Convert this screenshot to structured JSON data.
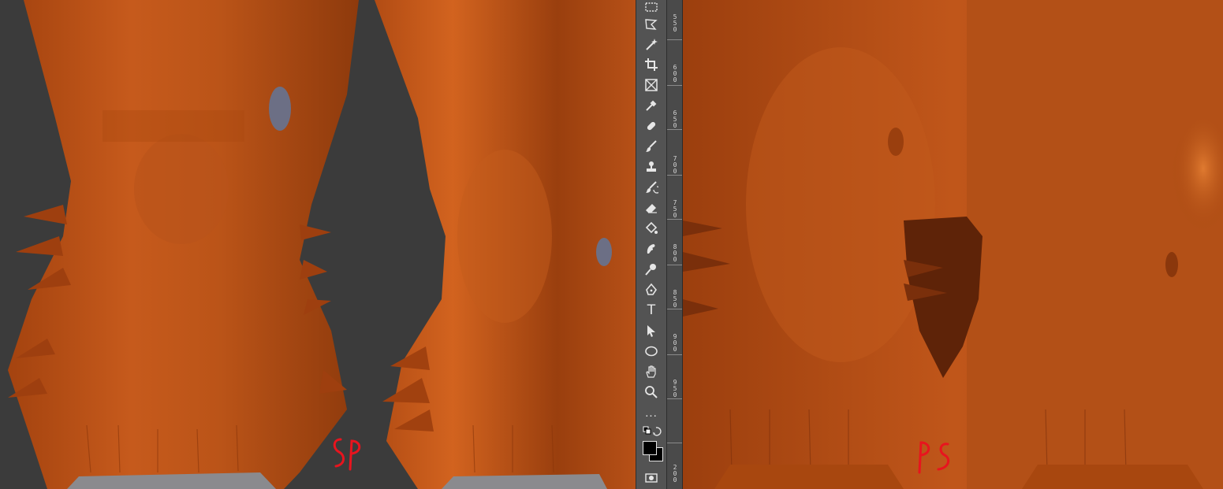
{
  "viewports": {
    "left": {
      "annotation": "SP"
    },
    "right": {
      "annotation": "PS"
    }
  },
  "toolbar": {
    "tools": [
      {
        "name": "marquee-tool",
        "icon": "rect-marquee-icon"
      },
      {
        "name": "lasso-tool",
        "icon": "polygon-lasso-icon"
      },
      {
        "name": "magic-wand-tool",
        "icon": "magic-wand-icon"
      },
      {
        "name": "crop-tool",
        "icon": "crop-icon"
      },
      {
        "name": "frame-tool",
        "icon": "frame-icon"
      },
      {
        "name": "eyedropper-tool",
        "icon": "eyedropper-icon"
      },
      {
        "name": "healing-brush-tool",
        "icon": "bandage-icon"
      },
      {
        "name": "brush-tool",
        "icon": "brush-icon"
      },
      {
        "name": "clone-stamp-tool",
        "icon": "stamp-icon"
      },
      {
        "name": "history-brush-tool",
        "icon": "history-brush-icon"
      },
      {
        "name": "eraser-tool",
        "icon": "eraser-icon"
      },
      {
        "name": "paint-bucket-tool",
        "icon": "bucket-icon"
      },
      {
        "name": "smudge-tool",
        "icon": "smudge-icon"
      },
      {
        "name": "dodge-tool",
        "icon": "dodge-icon"
      },
      {
        "name": "pen-tool",
        "icon": "pen-icon"
      },
      {
        "name": "type-tool",
        "icon": "type-icon",
        "label": "T"
      },
      {
        "name": "path-selection-tool",
        "icon": "arrow-icon"
      },
      {
        "name": "ellipse-tool",
        "icon": "ellipse-icon"
      },
      {
        "name": "hand-tool",
        "icon": "hand-icon"
      },
      {
        "name": "zoom-tool",
        "icon": "magnifier-icon"
      },
      {
        "name": "more-tools",
        "icon": "ellipsis-icon",
        "label": "..."
      }
    ],
    "colors": {
      "foreground": "#000000",
      "background": "#000000"
    }
  },
  "ruler": {
    "labels": [
      "550",
      "600",
      "650",
      "700",
      "750",
      "800",
      "850",
      "900",
      "950",
      "200"
    ]
  },
  "palette": {
    "fur_base": "#c2571a",
    "fur_dark": "#7a2f0b",
    "fur_light": "#d9692a",
    "bg_gray": "#3b3b3b",
    "annotation_red": "#e8141e"
  }
}
